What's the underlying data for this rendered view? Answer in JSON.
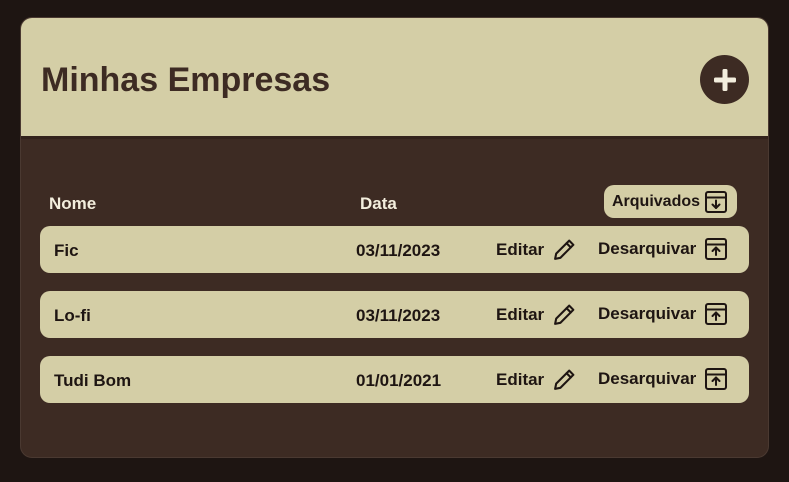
{
  "header": {
    "title": "Minhas Empresas",
    "add_icon": "plus-icon"
  },
  "table": {
    "columns": {
      "name": "Nome",
      "date": "Data"
    },
    "archived_button": {
      "label": "Arquivados",
      "icon": "archive-down-icon"
    },
    "rows": [
      {
        "name": "Fic",
        "date": "03/11/2023",
        "edit_label": "Editar",
        "unarchive_label": "Desarquivar"
      },
      {
        "name": "Lo-fi",
        "date": "03/11/2023",
        "edit_label": "Editar",
        "unarchive_label": "Desarquivar"
      },
      {
        "name": "Tudi Bom",
        "date": "01/01/2021",
        "edit_label": "Editar",
        "unarchive_label": "Desarquivar"
      }
    ]
  },
  "colors": {
    "page_background": "#1e1512",
    "panel_background": "#3d2b23",
    "header_background": "#d4cea6",
    "row_background": "#d4cea6",
    "text_dark": "#3d2b23",
    "text_light": "#f3eedd"
  }
}
